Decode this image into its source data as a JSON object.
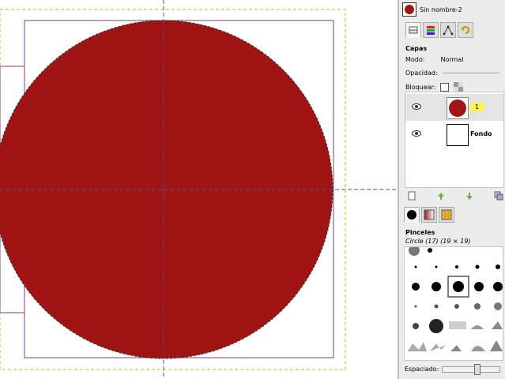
{
  "colors": {
    "circle_fill": "#a01414",
    "guide": "#3b5a86",
    "selection": "#333333",
    "layer_boundary": "#bfbf00",
    "canvas_border": "#7c3f7c",
    "name_highlight": "#fff44a"
  },
  "image": {
    "title": "Sin nombre-2"
  },
  "tabs": [
    {
      "icon": "layers-icon",
      "active": true
    },
    {
      "icon": "channels-icon",
      "active": false
    },
    {
      "icon": "paths-icon",
      "active": false
    },
    {
      "icon": "undo-history-icon",
      "active": false
    }
  ],
  "layers_panel": {
    "title": "Capas",
    "mode_label": "Modo:",
    "mode_value": "Normal",
    "opacity_label": "Opacidad:",
    "lock_label": "Bloquear:",
    "layers": [
      {
        "name": "1",
        "visible": true,
        "selected": true
      },
      {
        "name": "Fondo",
        "visible": true,
        "selected": false
      }
    ]
  },
  "layer_buttons": [
    "new-layer-icon",
    "raise-layer-icon",
    "lower-layer-icon",
    "duplicate-layer-icon"
  ],
  "brushes_panel": {
    "tabs": [
      {
        "icon": "brushes-icon",
        "active": true
      },
      {
        "icon": "gradients-icon",
        "active": false
      },
      {
        "icon": "patterns-icon",
        "active": false
      }
    ],
    "title": "Pinceles",
    "current": "Circle (17) (19 × 19)",
    "spacing_label": "Espaciado:",
    "spacing_level": 0.62
  }
}
